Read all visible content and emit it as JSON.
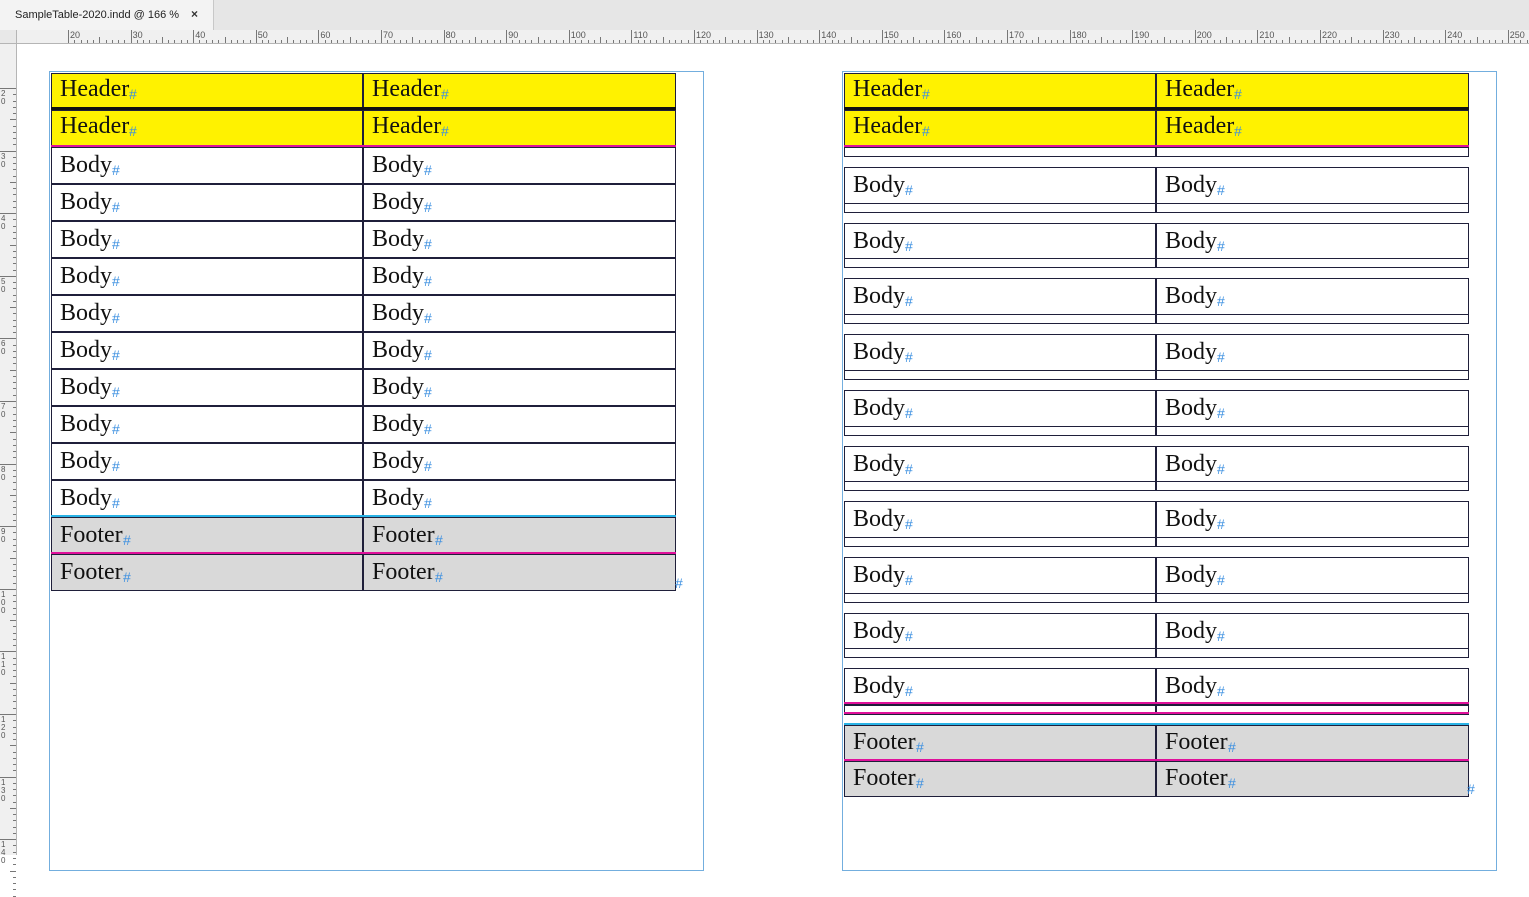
{
  "window": {
    "tab_title": "SampleTable-2020.indd @ 166 %",
    "tab_close": "×"
  },
  "ruler": {
    "horizontal_labels": [
      "20",
      "30",
      "40",
      "50",
      "60",
      "70",
      "80",
      "90",
      "100",
      "110",
      "120",
      "130",
      "140",
      "150",
      "160",
      "170",
      "180",
      "190",
      "200",
      "210",
      "220",
      "230",
      "240",
      "250"
    ],
    "vertical_labels": [
      "20",
      "30",
      "40",
      "50",
      "60",
      "70",
      "80",
      "90",
      "100",
      "110",
      "120",
      "130",
      "140"
    ]
  },
  "tables": [
    {
      "header_rows": [
        [
          "Header",
          "Header"
        ],
        [
          "Header",
          "Header"
        ]
      ],
      "body_rows": [
        [
          "Body",
          "Body"
        ],
        [
          "Body",
          "Body"
        ],
        [
          "Body",
          "Body"
        ],
        [
          "Body",
          "Body"
        ],
        [
          "Body",
          "Body"
        ],
        [
          "Body",
          "Body"
        ],
        [
          "Body",
          "Body"
        ],
        [
          "Body",
          "Body"
        ],
        [
          "Body",
          "Body"
        ],
        [
          "Body",
          "Body"
        ]
      ],
      "footer_rows": [
        [
          "Footer",
          "Footer"
        ],
        [
          "Footer",
          "Footer"
        ]
      ]
    },
    {
      "header_rows": [
        [
          "Header",
          "Header"
        ],
        [
          "Header",
          "Header"
        ]
      ],
      "body_rows": [
        [
          "Body",
          "Body"
        ],
        [
          "Body",
          "Body"
        ],
        [
          "Body",
          "Body"
        ],
        [
          "Body",
          "Body"
        ],
        [
          "Body",
          "Body"
        ],
        [
          "Body",
          "Body"
        ],
        [
          "Body",
          "Body"
        ],
        [
          "Body",
          "Body"
        ],
        [
          "Body",
          "Body"
        ],
        [
          "Body",
          "Body"
        ]
      ],
      "footer_rows": [
        [
          "Footer",
          "Footer"
        ],
        [
          "Footer",
          "Footer"
        ]
      ]
    }
  ],
  "hidden_char_glyph": "#",
  "colors": {
    "header_fill": "#fff200",
    "footer_fill": "#d9d9d9",
    "magenta_stroke": "#e0119b",
    "cyan_stroke": "#2ab3e6",
    "hidden_char": "#3b8fe0",
    "frame_edge": "#73aede"
  }
}
